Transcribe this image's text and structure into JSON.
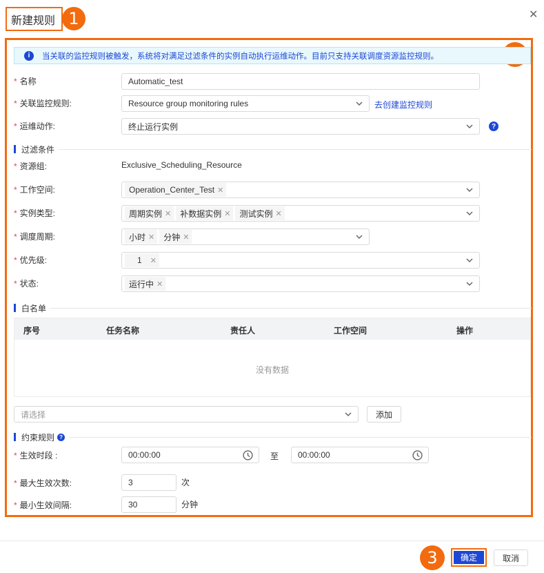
{
  "dialog": {
    "title": "新建规则",
    "close_icon": "close-icon",
    "callouts": [
      "1",
      "2",
      "3"
    ]
  },
  "info_banner": {
    "icon": "info-icon",
    "text": "当关联的监控规则被触发，系统将对满足过滤条件的实例自动执行运维动作。目前只支持关联调度资源监控规则。"
  },
  "form": {
    "name": {
      "label": "名称",
      "value": "Automatic_test"
    },
    "monitor_rule": {
      "label": "关联监控规则:",
      "value": "Resource group monitoring rules",
      "link": "去创建监控规则"
    },
    "action": {
      "label": "运维动作:",
      "value": "终止运行实例"
    }
  },
  "filter": {
    "title": "过滤条件",
    "resource_group": {
      "label": "资源组:",
      "value": "Exclusive_Scheduling_Resource"
    },
    "workspace": {
      "label": "工作空间:",
      "tags": [
        "Operation_Center_Test"
      ]
    },
    "instance_type": {
      "label": "实例类型:",
      "tags": [
        "周期实例",
        "补数据实例",
        "测试实例"
      ]
    },
    "schedule_cycle": {
      "label": "调度周期:",
      "tags": [
        "小时",
        "分钟"
      ]
    },
    "priority": {
      "label": "优先级:",
      "tags": [
        "1"
      ]
    },
    "status": {
      "label": "状态:",
      "tags": [
        "运行中"
      ]
    }
  },
  "whitelist": {
    "title": "白名单",
    "columns": [
      "序号",
      "任务名称",
      "责任人",
      "工作空间",
      "操作"
    ],
    "empty_text": "没有数据",
    "select_placeholder": "请选择",
    "add_button": "添加"
  },
  "constraints": {
    "title": "约束规则",
    "period": {
      "label": "生效时段 :",
      "start": "00:00:00",
      "separator": "至",
      "end": "00:00:00"
    },
    "max_times": {
      "label": "最大生效次数:",
      "value": "3",
      "unit": "次"
    },
    "min_interval": {
      "label": "最小生效间隔:",
      "value": "30",
      "unit": "分钟"
    }
  },
  "footer": {
    "confirm": "确定",
    "cancel": "取消"
  },
  "colors": {
    "accent": "#1e47d6",
    "callout": "#f26b0f",
    "required": "#e8424a",
    "banner_bg": "#e8f8fc"
  }
}
